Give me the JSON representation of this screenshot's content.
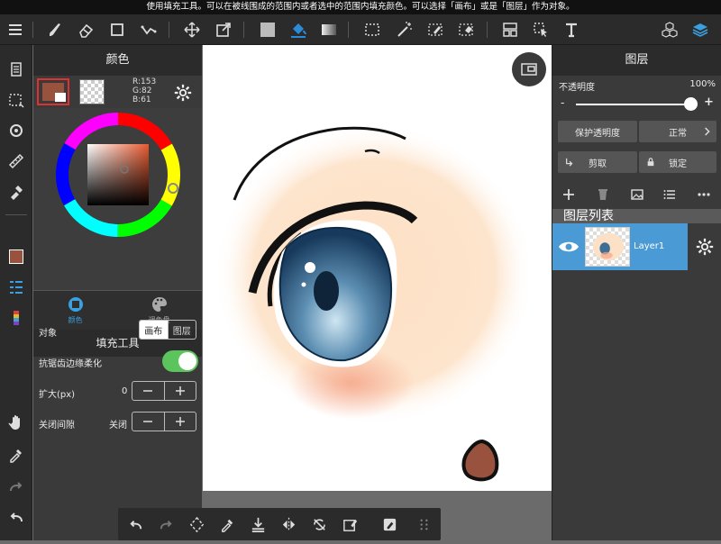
{
  "tip": "使用填充工具。可以在被线围成的范围内或者选中的范围内填充颜色。可以选择「画布」或是「图层」作为对象。",
  "color_panel": {
    "title": "颜色",
    "rgb": {
      "r": "R:153",
      "g": "G:82",
      "b": "B:61"
    },
    "tabs": [
      {
        "label": "颜色"
      },
      {
        "label": "调色盘"
      }
    ],
    "main_color": "#99523d"
  },
  "fill_tool": {
    "title": "填充工具",
    "target_label": "对象",
    "target_options": [
      "画布",
      "图层"
    ],
    "antialias_label": "抗锯齿边缘柔化",
    "antialias_on": true,
    "expand_label": "扩大(px)",
    "expand_value": "0",
    "close_gap_label": "关闭间隙",
    "close_gap_value": "关闭"
  },
  "layer_panel": {
    "title": "图层",
    "opacity_label": "不透明度",
    "opacity_value": "100%",
    "opacity_minus": "-",
    "opacity_plus": "+",
    "protect_alpha": "保护透明度",
    "blend_mode": "正常",
    "clip_label": "剪取",
    "lock_label": "锁定",
    "list_title": "图层列表",
    "layers": [
      {
        "name": "Layer1",
        "visible": true
      }
    ]
  },
  "colors": {
    "accent": "#4a9ad6",
    "toggle_on": "#5cc45c",
    "selected_border": "#e03030"
  }
}
